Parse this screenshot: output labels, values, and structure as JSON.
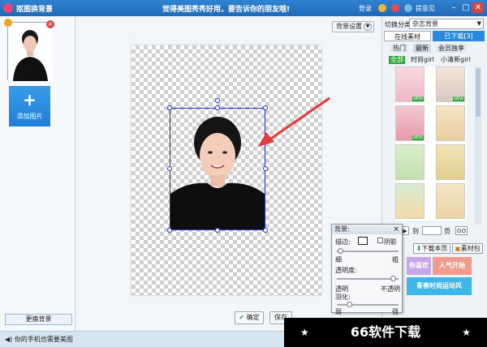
{
  "titlebar": {
    "app_title": "抠图换背景",
    "slogan": "觉得美图秀秀好用，要告诉你的朋友哦!",
    "login": "登录",
    "settings": "设置",
    "feedback": "提意见"
  },
  "left_panel": {
    "add_image_label": "添加图片",
    "replace_bg_label": "更换背景"
  },
  "center": {
    "bg_settings_label": "背景设置",
    "ok_label": "确定",
    "save_label": "保存"
  },
  "right_panel": {
    "category_label": "切换分类",
    "category_value": "杂志背景",
    "tab_online": "在线素材",
    "tab_downloaded": "已下载[3]",
    "subtabs": [
      "热门",
      "最新",
      "会员独享"
    ],
    "filters": [
      "全部",
      "时尚girl",
      "小清新girl"
    ],
    "new_tag": "NEW",
    "page_prefix": "到",
    "page_suffix": "页",
    "go_label": "GO",
    "download_page": "下载本页",
    "material_pack": "素材包",
    "banner_1": "你喜欢吧",
    "banner_2": "人气开始",
    "banner_3": "青春时尚运动风"
  },
  "bg_panel": {
    "title": "背景:",
    "border_label": "描边:",
    "shadow_label": "阴影",
    "thin_label": "细",
    "thick_label": "粗",
    "opacity_label": "透明度:",
    "transparent_label": "透明",
    "opaque_label": "不透明",
    "feather_label": "羽化:",
    "weak_label": "弱",
    "strong_label": "强"
  },
  "status": {
    "message": "你的手机也需要美图"
  },
  "watermark": {
    "text": "66软件下载"
  }
}
